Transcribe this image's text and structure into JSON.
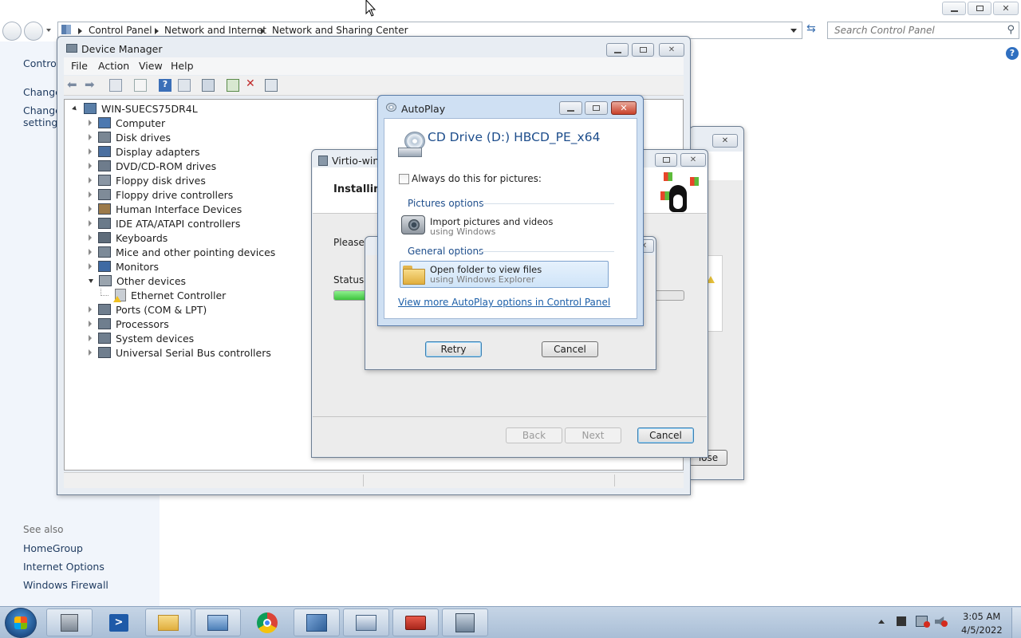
{
  "control_panel": {
    "breadcrumb": [
      "Control Panel",
      "Network and Internet",
      "Network and Sharing Center"
    ],
    "search_placeholder": "Search Control Panel",
    "left_links": [
      "Control",
      "Change",
      "Change",
      "settings"
    ],
    "see_also_label": "See also",
    "see_also": [
      "HomeGroup",
      "Internet Options",
      "Windows Firewall"
    ]
  },
  "device_manager": {
    "title": "Device Manager",
    "menu": [
      "File",
      "Action",
      "View",
      "Help"
    ],
    "root": "WIN-SUECS75DR4L",
    "nodes": [
      "Computer",
      "Disk drives",
      "Display adapters",
      "DVD/CD-ROM drives",
      "Floppy disk drives",
      "Floppy drive controllers",
      "Human Interface Devices",
      "IDE ATA/ATAPI controllers",
      "Keyboards",
      "Mice and other pointing devices",
      "Monitors",
      "Other devices"
    ],
    "child": "Ethernet Controller",
    "nodes_after": [
      "Ports (COM & LPT)",
      "Processors",
      "System devices",
      "Universal Serial Bus controllers"
    ]
  },
  "virtio": {
    "title": "Virtio-win-",
    "heading": "Installing",
    "please_wait": "Please w",
    "status_label": "Status:",
    "progress": 0.12,
    "back": "Back",
    "next": "Next",
    "cancel": "Cancel"
  },
  "back_dialog": {
    "close_partial": "lose"
  },
  "error_dialog": {
    "retry": "Retry",
    "cancel": "Cancel"
  },
  "autoplay": {
    "title": "AutoPlay",
    "drive": "CD Drive (D:) HBCD_PE_x64",
    "always_checkbox": "Always do this for pictures:",
    "always_checked": false,
    "pictures_section": "Pictures options",
    "import_title": "Import pictures and videos",
    "import_sub": "using Windows",
    "general_section": "General options",
    "open_title": "Open folder to view files",
    "open_sub": "using Windows Explorer",
    "more_link": "View more AutoPlay options in Control Panel"
  },
  "taskbar": {
    "time": "3:05 AM",
    "date": "4/5/2022"
  },
  "colors": {
    "accent_blue": "#1e4e8c",
    "link_blue": "#1c5fa8",
    "taskbar": "#b3c6dc",
    "progress_green": "#3cc43c"
  }
}
